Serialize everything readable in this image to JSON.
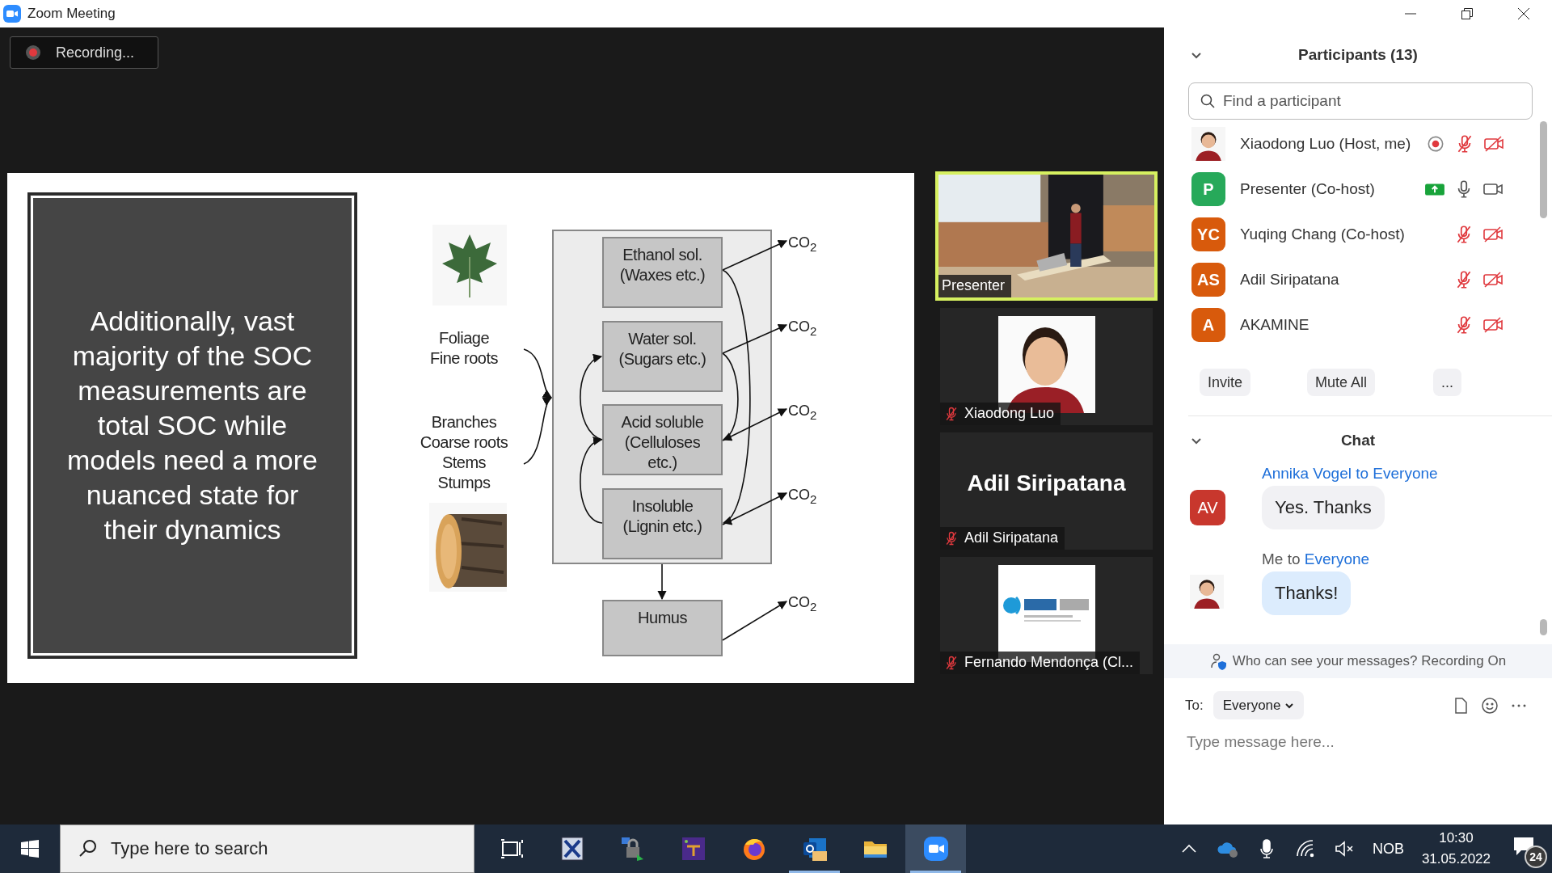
{
  "window": {
    "title": "Zoom Meeting"
  },
  "recording_badge": {
    "label": "Recording..."
  },
  "slide": {
    "text": "Additionally, vast majority of the SOC measurements are total SOC while models need a more nuanced state for their dynamics",
    "inputs": [
      {
        "label": "Foliage\nFine roots"
      },
      {
        "label": "Branches\nCoarse roots\nStems\nStumps"
      }
    ],
    "pools": [
      {
        "label": "Ethanol sol.\n(Waxes etc.)"
      },
      {
        "label": "Water sol.\n(Sugars etc.)"
      },
      {
        "label": "Acid soluble\n(Celluloses\netc.)"
      },
      {
        "label": "Insoluble\n(Lignin etc.)"
      }
    ],
    "humus": "Humus",
    "outputs": [
      "CO$_{2}$",
      "CO$_{2}$",
      "CO$_{2}$",
      "CO$_{2}$",
      "CO$_{2}$"
    ]
  },
  "video_tiles": [
    {
      "kind": "video",
      "label": "Presenter",
      "speaking": true,
      "muted": false
    },
    {
      "label": "Xiaodong Luo",
      "speaking": false,
      "muted": true
    },
    {
      "kind": "name",
      "display_name": "Adil Siripatana",
      "label": "Adil Siripatana",
      "speaking": false,
      "muted": true
    },
    {
      "kind": "logo",
      "label": "Fernando Mendonça (Cl...",
      "speaking": false,
      "muted": true
    }
  ],
  "participants": {
    "title": "Participants (13)",
    "search": {
      "placeholder": "Find a participant"
    },
    "items": [
      {
        "name": "Xiaodong Luo (Host, me)",
        "recording": true,
        "sharing": false,
        "mic_muted": true,
        "video_off": true
      },
      {
        "kind": "initials",
        "initials": "P",
        "color": "#27a95a",
        "name": "Presenter (Co-host)",
        "recording": false,
        "sharing": true,
        "mic_muted": false,
        "video_off": false
      },
      {
        "kind": "initials",
        "initials": "YC",
        "color": "#d85a0c",
        "name": "Yuqing Chang (Co-host)",
        "recording": false,
        "sharing": false,
        "mic_muted": true,
        "video_off": true
      },
      {
        "kind": "initials",
        "initials": "AS",
        "color": "#d85a0c",
        "name": "Adil Siripatana",
        "recording": false,
        "sharing": false,
        "mic_muted": true,
        "video_off": true
      },
      {
        "kind": "initials",
        "initials": "A",
        "color": "#d85a0c",
        "name": "AKAMINE",
        "recording": false,
        "sharing": false,
        "mic_muted": true,
        "video_off": true
      }
    ],
    "buttons": [
      "Invite",
      "Mute All",
      "..."
    ]
  },
  "chat": {
    "title": "Chat",
    "messages": [
      {
        "kind": "initials",
        "initials": "AV",
        "color": "#c8372d",
        "from": "Annika Vogel",
        "connector": "to",
        "recipient": "Everyone",
        "text": "Yes. Thanks",
        "mine": false
      },
      {
        "from": "Me",
        "connector": "to",
        "recipient": "Everyone",
        "text": "Thanks!",
        "mine": true
      }
    ],
    "notice": "Who can see your messages? Recording On",
    "to_label": "To:",
    "recipient": "Everyone",
    "placeholder": "Type message here..."
  },
  "taskbar": {
    "search_placeholder": "Type here to search",
    "apps": [
      {
        "kind": "task_view",
        "running": false,
        "active": false
      },
      {
        "kind": "xserver",
        "running": false,
        "active": false
      },
      {
        "kind": "vpn",
        "running": false,
        "active": false
      },
      {
        "kind": "tex",
        "running": false,
        "active": false
      },
      {
        "kind": "firefox",
        "running": false,
        "active": false
      },
      {
        "kind": "outlook",
        "running": true,
        "active": false
      },
      {
        "kind": "explorer",
        "running": false,
        "active": false
      },
      {
        "kind": "zoom",
        "running": true,
        "active": true
      }
    ],
    "language": "NOB",
    "time": "10:30",
    "date": "31.05.2022",
    "notifications": "24"
  }
}
